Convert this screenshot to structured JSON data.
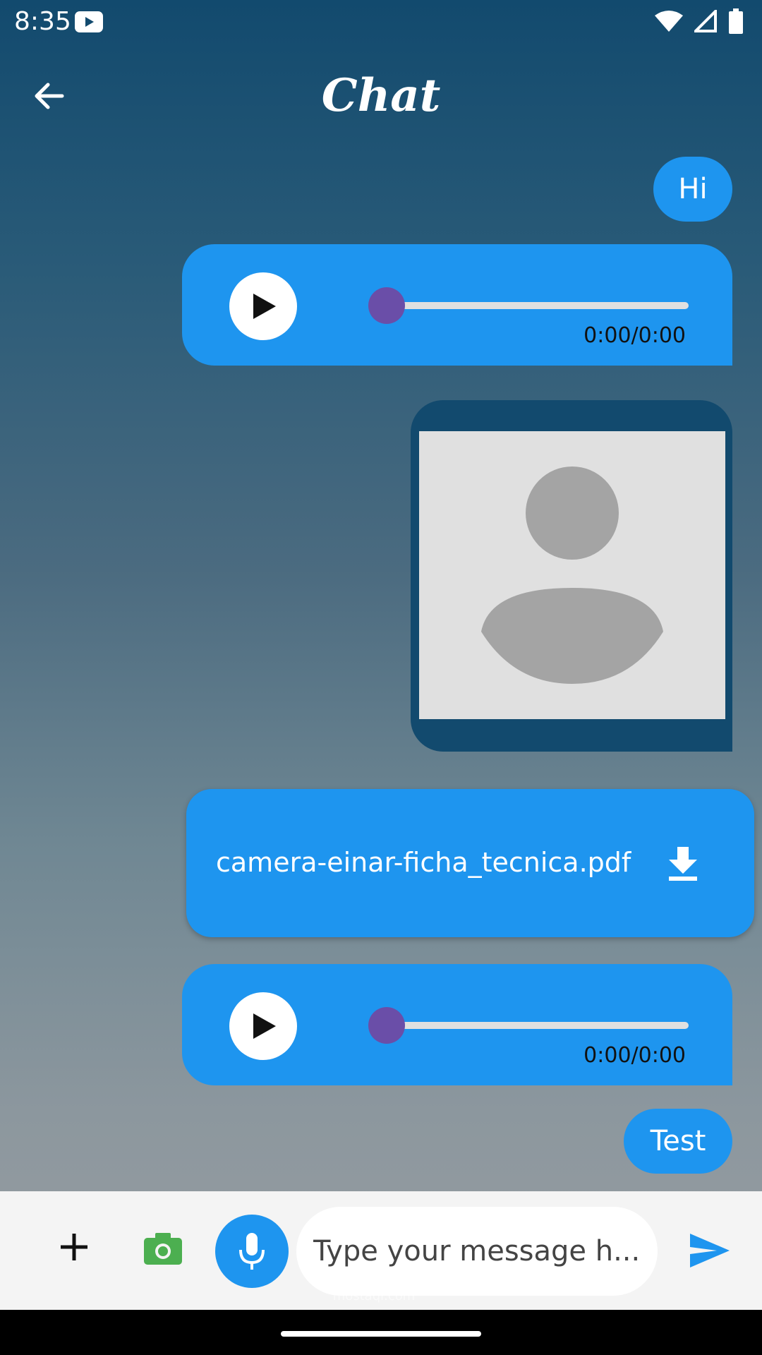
{
  "status_bar": {
    "time": "8:35"
  },
  "app_bar": {
    "title": "Chat"
  },
  "messages": [
    {
      "type": "text",
      "text": "Hi"
    },
    {
      "type": "audio",
      "time": "0:00/0:00",
      "progress": 0
    },
    {
      "type": "image"
    },
    {
      "type": "file",
      "filename": "camera-einar-ficha_tecnica.pdf"
    },
    {
      "type": "audio",
      "time": "0:00/0:00",
      "progress": 0
    },
    {
      "type": "text",
      "text": "Test"
    }
  ],
  "composer": {
    "placeholder": "Type your message h..."
  },
  "watermark": {
    "text": "mostaql.com"
  },
  "colors": {
    "bubble": "#1e95ef",
    "image_bubble": "#124a6e",
    "audio_thumb": "#6a4ea8"
  }
}
